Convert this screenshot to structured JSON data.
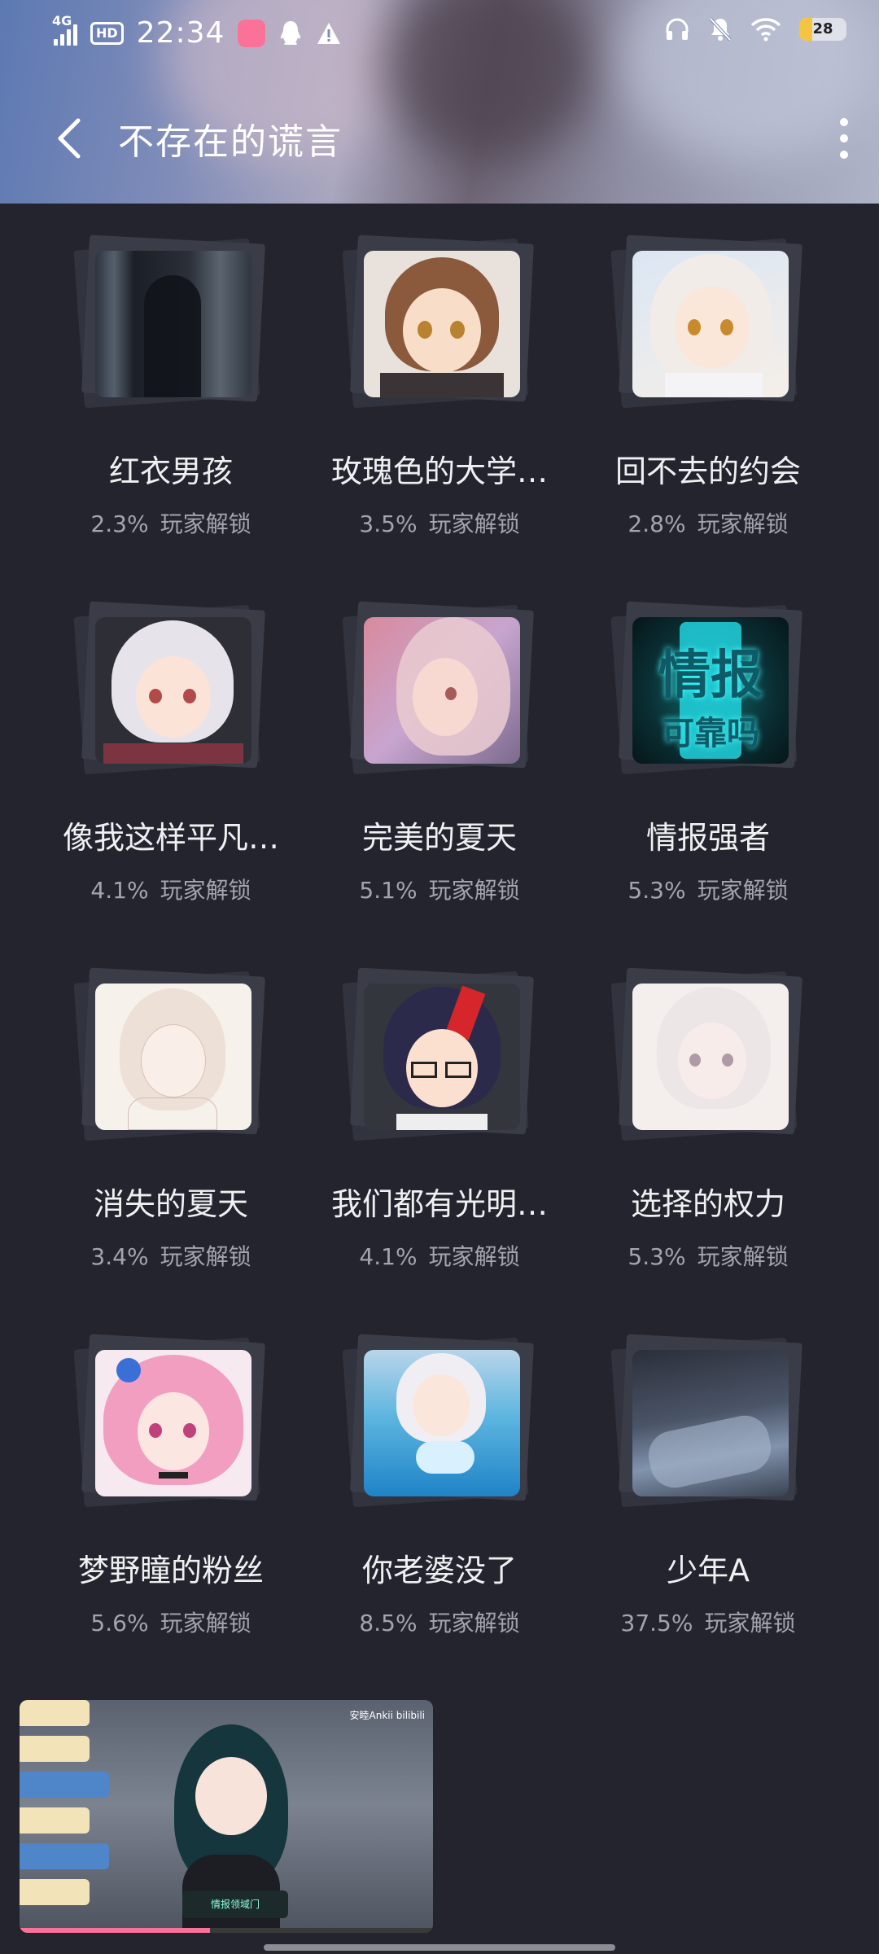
{
  "status_bar": {
    "network": "4G",
    "hd": "HD",
    "time": "22:34",
    "battery": "28"
  },
  "nav": {
    "title": "不存在的谎言"
  },
  "achievements": [
    {
      "name": "红衣男孩",
      "percent": "2.3%",
      "unlock_label": "玩家解锁",
      "image": "dark-window-silhouette"
    },
    {
      "name": "玫瑰色的大学…",
      "percent": "3.5%",
      "unlock_label": "玩家解锁",
      "image": "brown-hair-girl"
    },
    {
      "name": "回不去的约会",
      "percent": "2.8%",
      "unlock_label": "玩家解锁",
      "image": "white-hair-girl"
    },
    {
      "name": "像我这样平凡…",
      "percent": "4.1%",
      "unlock_label": "玩家解锁",
      "image": "silver-hair-girl"
    },
    {
      "name": "完美的夏天",
      "percent": "5.1%",
      "unlock_label": "玩家解锁",
      "image": "pink-hair-girl-profile"
    },
    {
      "name": "情报强者",
      "percent": "5.3%",
      "unlock_label": "玩家解锁",
      "image": "info-card"
    },
    {
      "name": "消失的夏天",
      "percent": "3.4%",
      "unlock_label": "玩家解锁",
      "image": "sketch-girl"
    },
    {
      "name": "我们都有光明…",
      "percent": "4.1%",
      "unlock_label": "玩家解锁",
      "image": "glasses-boy"
    },
    {
      "name": "选择的权力",
      "percent": "5.3%",
      "unlock_label": "玩家解锁",
      "image": "pale-sketch-girl"
    },
    {
      "name": "梦野瞳的粉丝",
      "percent": "5.6%",
      "unlock_label": "玩家解锁",
      "image": "pink-twintail-girl"
    },
    {
      "name": "你老婆没了",
      "percent": "8.5%",
      "unlock_label": "玩家解锁",
      "image": "pool-girl"
    },
    {
      "name": "少年A",
      "percent": "37.5%",
      "unlock_label": "玩家解锁",
      "image": "dark-bedroom"
    }
  ],
  "info_card_text": {
    "line1": "情报",
    "line2": "可靠吗"
  },
  "mini_player": {
    "brand": "安睦Ankii bilibili",
    "caption": "情报领域门",
    "progress": 0.46
  }
}
